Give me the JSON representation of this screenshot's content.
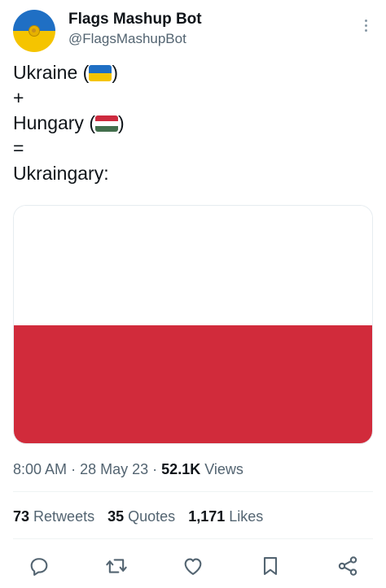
{
  "account": {
    "display_name": "Flags Mashup Bot",
    "handle": "@FlagsMashupBot",
    "avatar_colors": {
      "top": "#1f6fc4",
      "bottom": "#f5c400",
      "emblem": "#e6b100"
    }
  },
  "tweet": {
    "line1_country": "Ukraine",
    "line2": "+",
    "line3_country": "Hungary",
    "line4": "=",
    "line5": "Ukraingary:",
    "paren_open": "(",
    "paren_close": ")",
    "flag_emoji_colors": {
      "ukraine": [
        "#1f6fc4",
        "#f5c400"
      ],
      "hungary": [
        "#cd2a3e",
        "#ffffff",
        "#436f4d"
      ]
    },
    "image_flag_colors": {
      "top": "#ffffff",
      "bottom": "#d12b3b"
    }
  },
  "meta": {
    "time": "8:00 AM",
    "sep1": "·",
    "date": "28 May 23",
    "sep2": "·",
    "views_count": "52.1K",
    "views_label": "Views"
  },
  "stats": {
    "retweets_count": "73",
    "retweets_label": "Retweets",
    "quotes_count": "35",
    "quotes_label": "Quotes",
    "likes_count": "1,171",
    "likes_label": "Likes"
  },
  "actions": [
    "reply-icon",
    "retweet-icon",
    "like-icon",
    "bookmark-icon",
    "share-icon"
  ]
}
